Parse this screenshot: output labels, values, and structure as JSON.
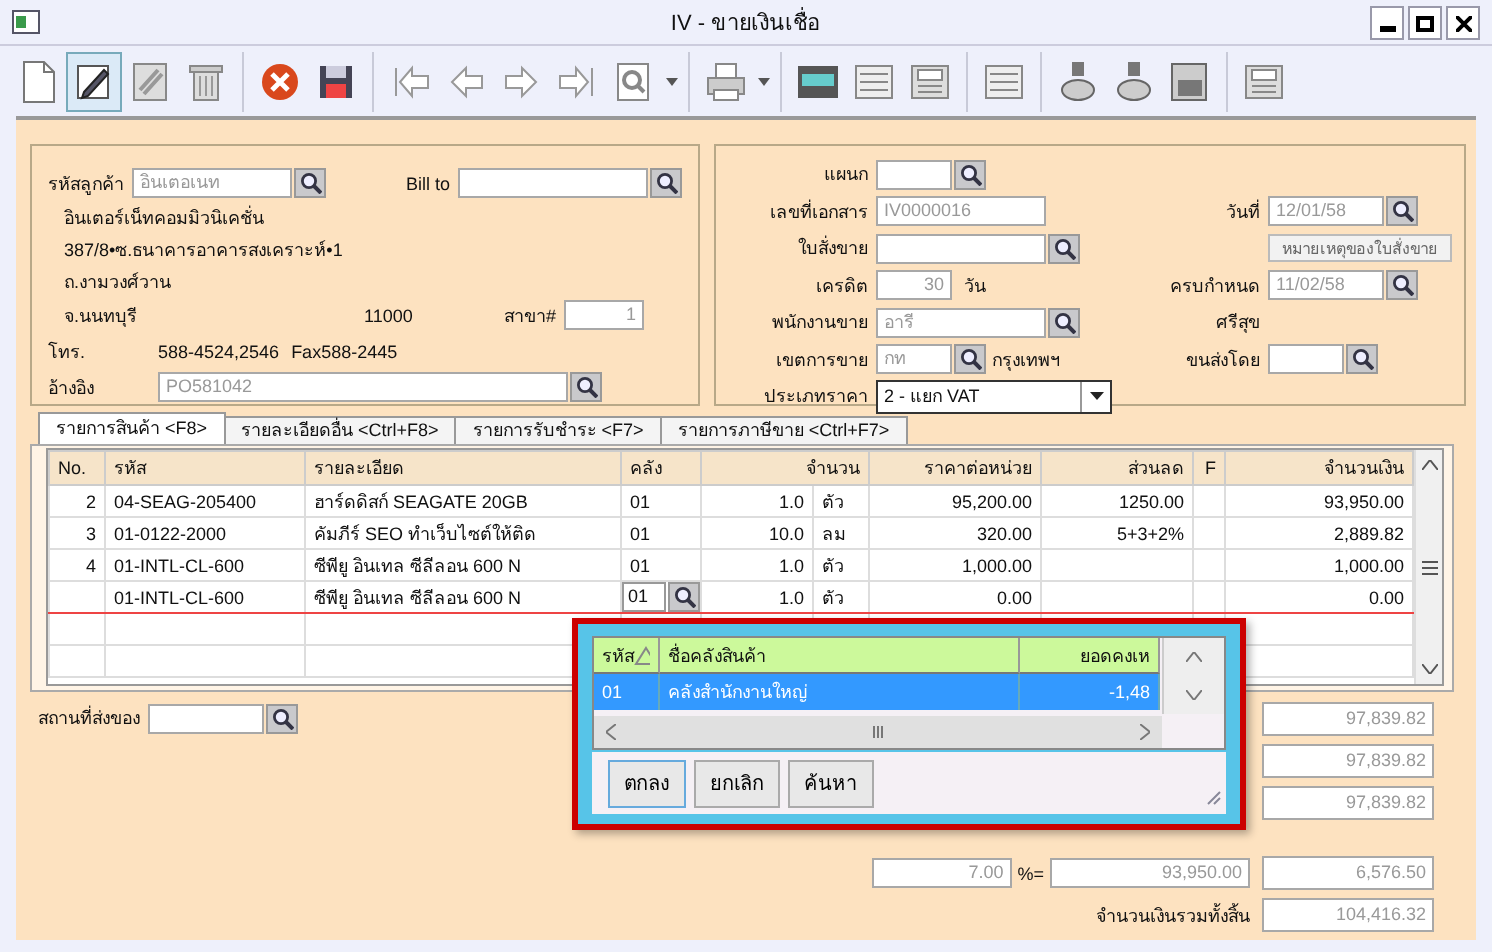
{
  "window": {
    "title": "IV - ขายเงินเชื่อ"
  },
  "customer": {
    "code_label": "รหัสลูกค้า",
    "code": "อินเตอเนท",
    "bill_to_label": "Bill to",
    "name": "อินเตอร์เน็ทคอมมิวนิเคชั่น",
    "address_1": "387/8•ซ.ธนาคารอาคารสงเคราะห์•1",
    "address_2": "ถ.งามวงศ์วาน",
    "province": "จ.นนทบุรี",
    "postcode": "11000",
    "branch_label": "สาขา#",
    "branch": "1",
    "phone_label": "โทร.",
    "phone": "588-4524,2546",
    "fax": "Fax588-2445",
    "reference_label": "อ้างอิง",
    "reference": "PO581042"
  },
  "document": {
    "department_label": "แผนก",
    "number_label": "เลขที่เอกสาร",
    "number": "IV0000016",
    "date_label": "วันที่",
    "date": "12/01/58",
    "sales_order_label": "ใบสั่งขาย",
    "order_note_button": "หมายเหตุของใบสั่งขาย",
    "credit_label": "เครดิต",
    "credit": "30",
    "credit_unit": "วัน",
    "due_label": "ครบกำหนด",
    "due_date": "11/02/58",
    "salesperson_label": "พนักงานขาย",
    "salesperson": "อารี",
    "salesperson_surname": "ศรีสุข",
    "area_label": "เขตการขาย",
    "area": "กท",
    "area_name": "กรุงเทพฯ",
    "shipper_label": "ขนส่งโดย",
    "price_type_label": "ประเภทราคา",
    "price_type": "2 - แยก VAT"
  },
  "tabs": [
    {
      "label": "รายการสินค้า <F8>",
      "selected": true
    },
    {
      "label": "รายละเอียดอื่น  <Ctrl+F8>",
      "selected": false
    },
    {
      "label": "รายการรับชำระ <F7>",
      "selected": false
    },
    {
      "label": "รายการภาษีขาย <Ctrl+F7>",
      "selected": false
    }
  ],
  "table": {
    "columns": [
      "No.",
      "รหัส",
      "รายละเอียด",
      "คลัง",
      "จำนวน",
      "ราคาต่อหน่วย",
      "ส่วนลด",
      "F",
      "จำนวนเงิน"
    ],
    "rows": [
      {
        "no": "2",
        "code": "04-SEAG-205400",
        "description": "ฮาร์ดดิสก์ SEAGATE 20GB",
        "warehouse": "01",
        "qty": "1.0",
        "unit": "ตัว",
        "price": "95,200.00",
        "discount": "1250.00",
        "amount": "93,950.00",
        "selected": false
      },
      {
        "no": "3",
        "code": "01-0122-2000",
        "description": "คัมภีร์ SEO ทำเว็บไซต์ให้ติด",
        "warehouse": "01",
        "qty": "10.0",
        "unit": "ลม",
        "price": "320.00",
        "discount": "5+3+2%",
        "amount": "2,889.82",
        "selected": false
      },
      {
        "no": "4",
        "code": "01-INTL-CL-600",
        "description": "ซีพียู อินเทล ซีลีลอน 600 N",
        "warehouse": "01",
        "qty": "1.0",
        "unit": "ตัว",
        "price": "1,000.00",
        "discount": "",
        "amount": "1,000.00",
        "selected": false
      },
      {
        "no": "",
        "code": "01-INTL-CL-600",
        "description": "ซีพียู อินเทล ซีลีลอน 600 N",
        "warehouse": "01",
        "qty": "1.0",
        "unit": "ตัว",
        "price": "0.00",
        "discount": "",
        "amount": "0.00",
        "selected": true
      }
    ]
  },
  "delivery": {
    "label": "สถานที่ส่งของ"
  },
  "totals": {
    "subtotal_1": "97,839.82",
    "subtotal_2": "97,839.82",
    "subtotal_3": "97,839.82",
    "vat_rate": "7.00",
    "percent_sign": "%=",
    "vat_base": "93,950.00",
    "vat_amount": "6,576.50",
    "grand_total_label": "จำนวนเงินรวมทั้งสิ้น",
    "grand_total": "104,416.32"
  },
  "popup": {
    "columns": [
      "รหัส",
      "ชื่อคลังสินค้า",
      "ยอดคงเห"
    ],
    "rows": [
      {
        "code": "01",
        "name": "คลังสำนักงานใหญ่",
        "balance": "-1,48",
        "selected": true
      }
    ],
    "buttons": [
      "ตกลง",
      "ยกเลิก",
      "ค้นหา"
    ]
  }
}
